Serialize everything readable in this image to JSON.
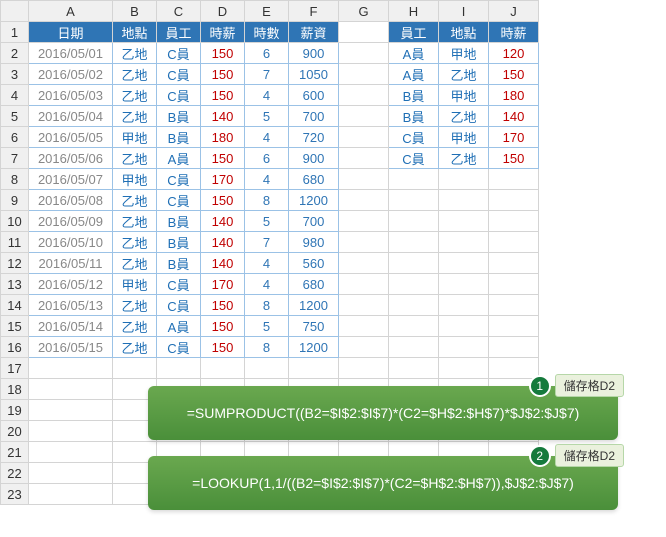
{
  "cols": [
    "A",
    "B",
    "C",
    "D",
    "E",
    "F",
    "G",
    "H",
    "I",
    "J"
  ],
  "rowCount": 23,
  "t1": {
    "headers": [
      "日期",
      "地點",
      "員工",
      "時薪",
      "時數",
      "薪資"
    ],
    "rows": [
      {
        "date": "2016/05/01",
        "loc": "乙地",
        "emp": "C員",
        "rate": 150,
        "qty": 6,
        "amt": 900
      },
      {
        "date": "2016/05/02",
        "loc": "乙地",
        "emp": "C員",
        "rate": 150,
        "qty": 7,
        "amt": 1050
      },
      {
        "date": "2016/05/03",
        "loc": "乙地",
        "emp": "C員",
        "rate": 150,
        "qty": 4,
        "amt": 600
      },
      {
        "date": "2016/05/04",
        "loc": "乙地",
        "emp": "B員",
        "rate": 140,
        "qty": 5,
        "amt": 700
      },
      {
        "date": "2016/05/05",
        "loc": "甲地",
        "emp": "B員",
        "rate": 180,
        "qty": 4,
        "amt": 720
      },
      {
        "date": "2016/05/06",
        "loc": "乙地",
        "emp": "A員",
        "rate": 150,
        "qty": 6,
        "amt": 900
      },
      {
        "date": "2016/05/07",
        "loc": "甲地",
        "emp": "C員",
        "rate": 170,
        "qty": 4,
        "amt": 680
      },
      {
        "date": "2016/05/08",
        "loc": "乙地",
        "emp": "C員",
        "rate": 150,
        "qty": 8,
        "amt": 1200
      },
      {
        "date": "2016/05/09",
        "loc": "乙地",
        "emp": "B員",
        "rate": 140,
        "qty": 5,
        "amt": 700
      },
      {
        "date": "2016/05/10",
        "loc": "乙地",
        "emp": "B員",
        "rate": 140,
        "qty": 7,
        "amt": 980
      },
      {
        "date": "2016/05/11",
        "loc": "乙地",
        "emp": "B員",
        "rate": 140,
        "qty": 4,
        "amt": 560
      },
      {
        "date": "2016/05/12",
        "loc": "甲地",
        "emp": "C員",
        "rate": 170,
        "qty": 4,
        "amt": 680
      },
      {
        "date": "2016/05/13",
        "loc": "乙地",
        "emp": "C員",
        "rate": 150,
        "qty": 8,
        "amt": 1200
      },
      {
        "date": "2016/05/14",
        "loc": "乙地",
        "emp": "A員",
        "rate": 150,
        "qty": 5,
        "amt": 750
      },
      {
        "date": "2016/05/15",
        "loc": "乙地",
        "emp": "C員",
        "rate": 150,
        "qty": 8,
        "amt": 1200
      }
    ]
  },
  "t2": {
    "headers": [
      "員工",
      "地點",
      "時薪"
    ],
    "rows": [
      {
        "emp": "A員",
        "loc": "甲地",
        "rate": 120
      },
      {
        "emp": "A員",
        "loc": "乙地",
        "rate": 150
      },
      {
        "emp": "B員",
        "loc": "甲地",
        "rate": 180
      },
      {
        "emp": "B員",
        "loc": "乙地",
        "rate": 140
      },
      {
        "emp": "C員",
        "loc": "甲地",
        "rate": 170
      },
      {
        "emp": "C員",
        "loc": "乙地",
        "rate": 150
      }
    ]
  },
  "formula1": {
    "num": "1",
    "label": "儲存格D2",
    "text": "=SUMPRODUCT((B2=$I$2:$I$7)*(C2=$H$2:$H$7)*$J$2:$J$7)"
  },
  "formula2": {
    "num": "2",
    "label": "儲存格D2",
    "text": "=LOOKUP(1,1/((B2=$I$2:$I$7)*(C2=$H$2:$H$7)),$J$2:$J$7)"
  }
}
